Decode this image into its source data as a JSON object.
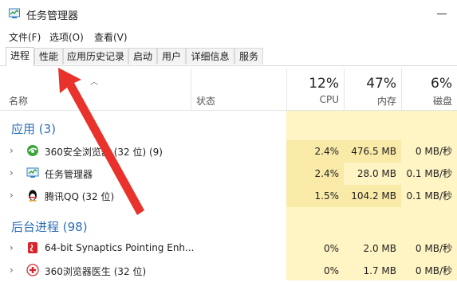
{
  "window": {
    "title": "任务管理器"
  },
  "menu": [
    "文件(F)",
    "选项(O)",
    "查看(V)"
  ],
  "tabs": [
    {
      "label": "进程",
      "active": true
    },
    {
      "label": "性能",
      "active": false
    },
    {
      "label": "应用历史记录",
      "active": false
    },
    {
      "label": "启动",
      "active": false
    },
    {
      "label": "用户",
      "active": false
    },
    {
      "label": "详细信息",
      "active": false
    },
    {
      "label": "服务",
      "active": false
    }
  ],
  "header": {
    "name_label": "名称",
    "status_label": "状态",
    "cpu_label": "CPU",
    "mem_label": "内存",
    "disk_label": "磁盘",
    "cpu_pct": "12%",
    "mem_pct": "47%",
    "disk_pct": "6%"
  },
  "groups": {
    "apps": "应用 (3)",
    "background": "后台进程 (98)"
  },
  "rows": [
    {
      "name": "360安全浏览器 (32 位) (9)",
      "icon": "360-browser-icon",
      "cpu": "2.4%",
      "mem": "476.5 MB",
      "disk": "0 MB/秒"
    },
    {
      "name": "任务管理器",
      "icon": "task-manager-icon",
      "cpu": "2.4%",
      "mem": "28.0 MB",
      "disk": "0.1 MB/秒"
    },
    {
      "name": "腾讯QQ (32 位)",
      "icon": "qq-penguin-icon",
      "cpu": "1.5%",
      "mem": "104.2 MB",
      "disk": "0.1 MB/秒"
    },
    {
      "name": "64-bit Synaptics Pointing Enh...",
      "icon": "synaptics-icon",
      "cpu": "0%",
      "mem": "2.0 MB",
      "disk": "0 MB/秒"
    },
    {
      "name": "360浏览器医生 (32 位)",
      "icon": "browser-doctor-icon",
      "cpu": "0%",
      "mem": "1.7 MB",
      "disk": "0 MB/秒"
    }
  ],
  "colors": {
    "accent": "#2c6eb5",
    "highlight": "#f9eaa8",
    "shade": "#fff4c4",
    "annotation_arrow": "#e8322b"
  }
}
